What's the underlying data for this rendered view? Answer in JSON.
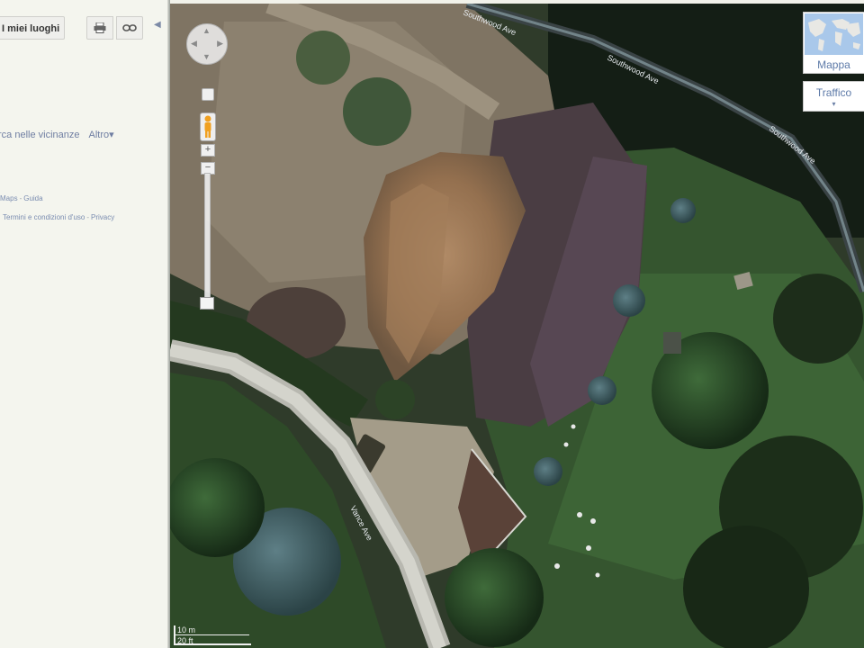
{
  "left_panel": {
    "my_places": "I miei luoghi",
    "print_icon": "printer-icon",
    "link_icon": "link-icon",
    "collapse_icon": "chevron-left-icon",
    "search_nearby": "rca nelle vicinanze",
    "more": "Altro",
    "more_caret": "▾",
    "footer_links_1": [
      "Maps",
      "Guida"
    ],
    "footer_links_2": [
      "Termini e condizioni d'uso",
      "Privacy"
    ]
  },
  "map": {
    "view": "satellite",
    "roads": [
      {
        "name": "Southwood Ave",
        "label": "Southwood Ave"
      },
      {
        "name": "Southwood Ave",
        "label": "Southwood Ave"
      },
      {
        "name": "Southwood Ave",
        "label": "Southwood Ave"
      },
      {
        "name": "Vance Ave",
        "label": "Vance Ave"
      }
    ],
    "controls": {
      "pan_icon": "pan-control-icon",
      "pegman_icon": "pegman-icon",
      "zoom_in": "+",
      "zoom_out": "−",
      "zoom_level": 0.05
    },
    "map_type": {
      "map_label": "Mappa",
      "traffic_label": "Traffico",
      "traffic_caret": "▾"
    },
    "scale": {
      "metric": "10 m",
      "imperial": "20 ft"
    }
  }
}
